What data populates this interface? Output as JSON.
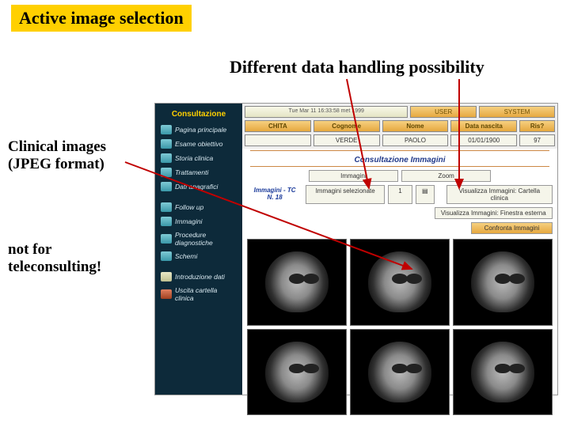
{
  "title": "Active image selection",
  "subtitle": "Different data handling possibility",
  "caption1_line1": "Clinical images",
  "caption1_line2": "(JPEG format)",
  "caption2_line1": "not for",
  "caption2_line2": "teleconsulting!",
  "sidebar": {
    "title": "Consultazione",
    "items": [
      {
        "label": "Pagina principale"
      },
      {
        "label": "Esame obiettivo"
      },
      {
        "label": "Storia clinica"
      },
      {
        "label": "Trattamenti"
      },
      {
        "label": "Dati anagrafici"
      }
    ],
    "items2": [
      {
        "label": "Follow up"
      },
      {
        "label": "Immagini"
      },
      {
        "label": "Procedure diagnostiche"
      },
      {
        "label": "Schemi"
      }
    ],
    "items3": [
      {
        "label": "Introduzione dati"
      },
      {
        "label": "Uscita cartella clinica"
      }
    ]
  },
  "topbar": {
    "timestamp": "Tue Mar 11 16:33:58 met 1999",
    "user_btn": "USER",
    "system_btn": "SYSTEM"
  },
  "header_table": {
    "cols": [
      "CHITA",
      "Cognome",
      "Nome",
      "Data nascita",
      "Ris?"
    ],
    "vals": [
      "",
      "VERDE",
      "PAOLO",
      "01/01/1900",
      "97"
    ]
  },
  "section_title": "Consultazione Immagini",
  "controls": {
    "col_img": "Immagini",
    "col_zoom": "Zoom",
    "tc_label_1": "Immagini - TC",
    "tc_label_2": "N. 18",
    "selezionate": "Immagini selezionate",
    "count": "1",
    "viz_cartella": "Visualizza Immagini: Cartella clinica",
    "viz_esterna": "Visualizza Immagini: Finestra esterna",
    "confronta": "Confronta Immagini"
  }
}
